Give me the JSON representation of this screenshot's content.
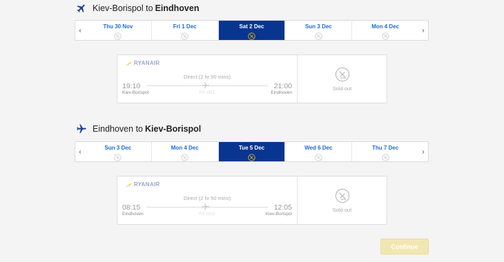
{
  "outbound": {
    "origin": "Kiev-Borispol",
    "connector": "to",
    "destination": "Eindhoven",
    "dates": [
      "Thu 30 Nov",
      "Fri 1 Dec",
      "Sat 2 Dec",
      "Sun 3 Dec",
      "Mon 4 Dec"
    ],
    "selected_index": 2,
    "flight": {
      "airline": "RYANAIR",
      "direct": "Direct  (2 hr 50 mins)",
      "dep_time": "19:10",
      "arr_time": "21:00",
      "dep_airport": "Kiev-Borispol",
      "arr_airport": "Eindhoven",
      "flight_no": "FR 1811",
      "status": "Sold out"
    }
  },
  "inbound": {
    "origin": "Eindhoven",
    "connector": "to",
    "destination": "Kiev-Borispol",
    "dates": [
      "Sun 3 Dec",
      "Mon 4 Dec",
      "Tue 5 Dec",
      "Wed 6 Dec",
      "Thu 7 Dec"
    ],
    "selected_index": 2,
    "flight": {
      "airline": "RYANAIR",
      "direct": "Direct  (2 hr 50 mins)",
      "dep_time": "08:15",
      "arr_time": "12:05",
      "dep_airport": "Eindhoven",
      "arr_airport": "Kiev-Borispol",
      "flight_no": "FR 1810",
      "status": "Sold out"
    }
  },
  "icons": {
    "prev": "chevron-left-icon",
    "next": "chevron-right-icon",
    "no_flights": "no-flights-icon",
    "plane": "plane-icon"
  },
  "colors": {
    "selected_bg": "#073590",
    "date_label": "#1f6bd8",
    "continue_bg": "#f2e7b3"
  },
  "continue_label": "Continue"
}
